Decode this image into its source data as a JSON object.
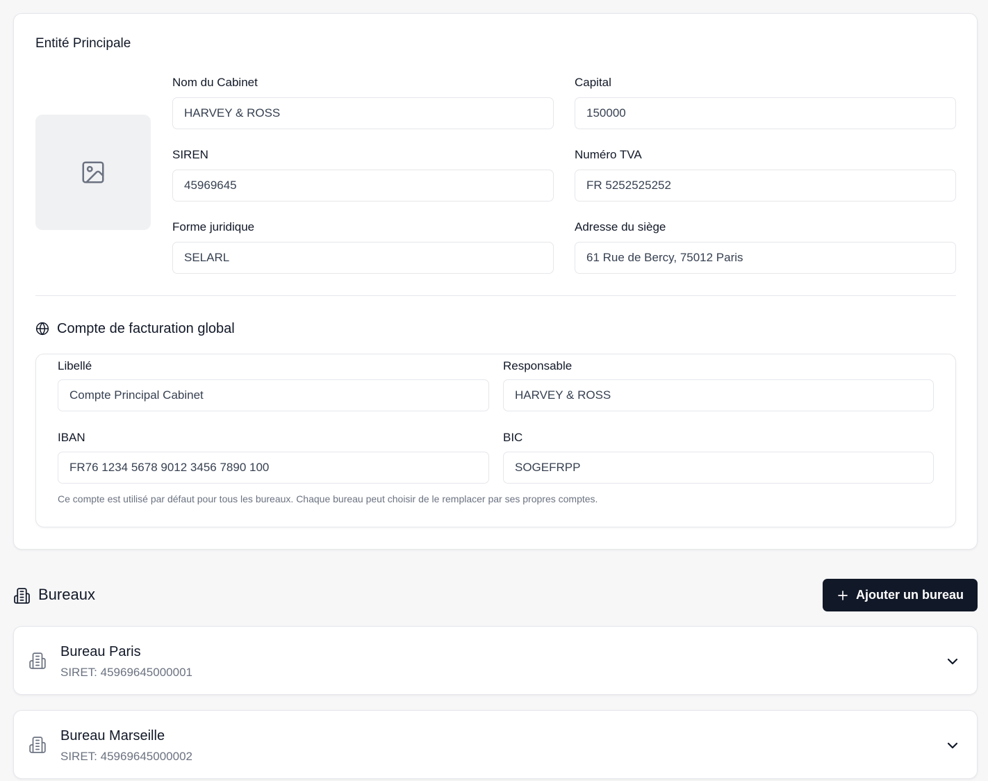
{
  "entity": {
    "title": "Entité Principale",
    "fields": {
      "nom": {
        "label": "Nom du Cabinet",
        "value": "HARVEY & ROSS"
      },
      "capital": {
        "label": "Capital",
        "value": "150000"
      },
      "siren": {
        "label": "SIREN",
        "value": "45969645"
      },
      "tva": {
        "label": "Numéro TVA",
        "value": "FR 5252525252"
      },
      "forme": {
        "label": "Forme juridique",
        "value": "SELARL"
      },
      "adresse": {
        "label": "Adresse du siège",
        "value": "61 Rue de Bercy, 75012 Paris"
      }
    }
  },
  "billing": {
    "title": "Compte de facturation global",
    "fields": {
      "libelle": {
        "label": "Libellé",
        "value": "Compte Principal Cabinet"
      },
      "responsable": {
        "label": "Responsable",
        "value": "HARVEY & ROSS"
      },
      "iban": {
        "label": "IBAN",
        "value": "FR76 1234 5678 9012 3456 7890 100"
      },
      "bic": {
        "label": "BIC",
        "value": "SOGEFRPP"
      }
    },
    "helper": "Ce compte est utilisé par défaut pour tous les bureaux. Chaque bureau peut choisir de le remplacer par ses propres comptes."
  },
  "bureaux": {
    "title": "Bureaux",
    "add_label": "Ajouter un bureau",
    "items": [
      {
        "name": "Bureau Paris",
        "siret": "SIRET: 45969645000001"
      },
      {
        "name": "Bureau Marseille",
        "siret": "SIRET: 45969645000002"
      }
    ]
  },
  "icons": {
    "logo_placeholder": "image-icon",
    "billing": "globe-icon",
    "bureaux": "building-icon",
    "office": "building-icon",
    "expand": "chevron-down-icon",
    "add": "plus-icon"
  },
  "colors": {
    "primary_button": "#111827",
    "border": "#e5e7eb",
    "muted_text": "#6b7280",
    "placeholder_bg": "#f0f1f3"
  }
}
